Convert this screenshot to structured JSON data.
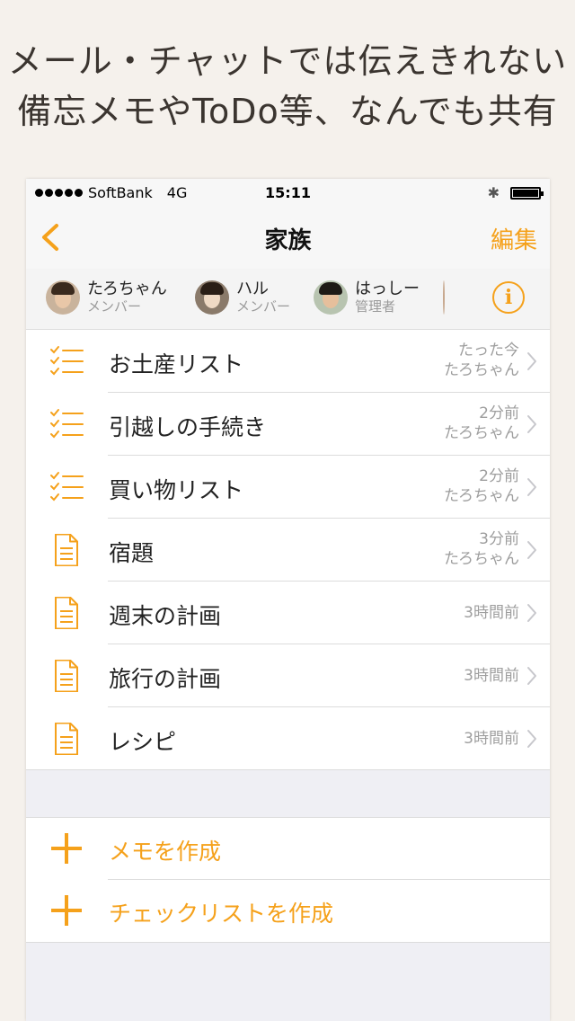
{
  "promo": {
    "line1": "メール・チャットでは伝えきれない",
    "line2": "備忘メモやToDo等、なんでも共有"
  },
  "statusbar": {
    "carrier": "SoftBank",
    "network": "4G",
    "time": "15:11"
  },
  "navbar": {
    "title": "家族",
    "edit_label": "編集"
  },
  "members": [
    {
      "name": "たろちゃん",
      "role": "メンバー"
    },
    {
      "name": "ハル",
      "role": "メンバー"
    },
    {
      "name": "はっしー",
      "role": "管理者"
    }
  ],
  "items": [
    {
      "type": "checklist",
      "title": "お土産リスト",
      "time": "たった今",
      "author": "たろちゃん"
    },
    {
      "type": "checklist",
      "title": "引越しの手続き",
      "time": "2分前",
      "author": "たろちゃん"
    },
    {
      "type": "checklist",
      "title": "買い物リスト",
      "time": "2分前",
      "author": "たろちゃん"
    },
    {
      "type": "memo",
      "title": "宿題",
      "time": "3分前",
      "author": "たろちゃん"
    },
    {
      "type": "memo",
      "title": "週末の計画",
      "time": "3時間前"
    },
    {
      "type": "memo",
      "title": "旅行の計画",
      "time": "3時間前"
    },
    {
      "type": "memo",
      "title": "レシピ",
      "time": "3時間前"
    }
  ],
  "actions": {
    "create_memo": "メモを作成",
    "create_checklist": "チェックリストを作成"
  },
  "colors": {
    "accent": "#f5a11b",
    "background": "#f5f1ec"
  }
}
